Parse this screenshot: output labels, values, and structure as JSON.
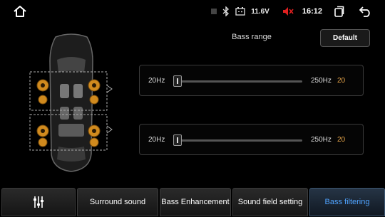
{
  "status_bar": {
    "icons": [
      "home-icon",
      "signal-icon",
      "bluetooth-icon",
      "battery-icon",
      "mute-icon",
      "recent-apps-icon",
      "back-icon"
    ],
    "battery_voltage": "11.6V",
    "time": "16:12",
    "mute_color": "#e02020"
  },
  "main": {
    "title": "Bass range",
    "default_button": "Default",
    "sliders": [
      {
        "min_label": "20Hz",
        "max_label": "250Hz",
        "value": "20"
      },
      {
        "min_label": "20Hz",
        "max_label": "250Hz",
        "value": "20"
      }
    ],
    "value_color": "#e8a64a"
  },
  "tabs": [
    {
      "icon": "equalizer-icon",
      "label": ""
    },
    {
      "label": "Surround sound"
    },
    {
      "label": "Bass Enhancement"
    },
    {
      "label": "Sound field setting"
    },
    {
      "label": "Bass filtering",
      "active": true
    }
  ],
  "accent": "#4fa3ff"
}
